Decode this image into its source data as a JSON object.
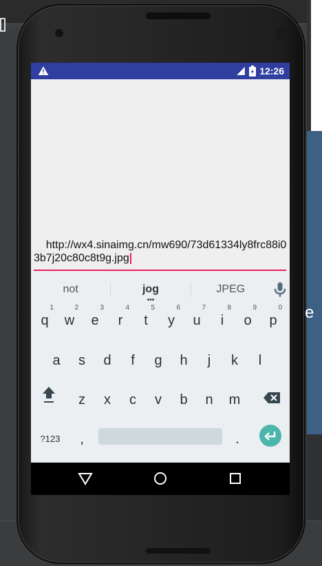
{
  "status": {
    "time": "12:26",
    "icons": [
      "alert-icon",
      "signal-icon",
      "battery-icon"
    ]
  },
  "url_field": {
    "value": "http://wx4.sinaimg.cn/mw690/73d61334ly8frc88i03b7j20c80c8t9g.jpg"
  },
  "keyboard": {
    "suggestions": [
      "not",
      "jog",
      "JPEG"
    ],
    "row1": [
      {
        "label": "q",
        "hint": "1"
      },
      {
        "label": "w",
        "hint": "2"
      },
      {
        "label": "e",
        "hint": "3"
      },
      {
        "label": "r",
        "hint": "4"
      },
      {
        "label": "t",
        "hint": "5"
      },
      {
        "label": "y",
        "hint": "6"
      },
      {
        "label": "u",
        "hint": "7"
      },
      {
        "label": "i",
        "hint": "8"
      },
      {
        "label": "o",
        "hint": "9"
      },
      {
        "label": "p",
        "hint": "0"
      }
    ],
    "row2": [
      "a",
      "s",
      "d",
      "f",
      "g",
      "h",
      "j",
      "k",
      "l"
    ],
    "row3": [
      "z",
      "x",
      "c",
      "v",
      "b",
      "n",
      "m"
    ],
    "bottom": {
      "symbols_label": "?123",
      "comma": ",",
      "period": "."
    }
  },
  "colors": {
    "status_bar": "#303f9f",
    "accent": "#e91e63",
    "enter_key": "#4db6ac"
  }
}
